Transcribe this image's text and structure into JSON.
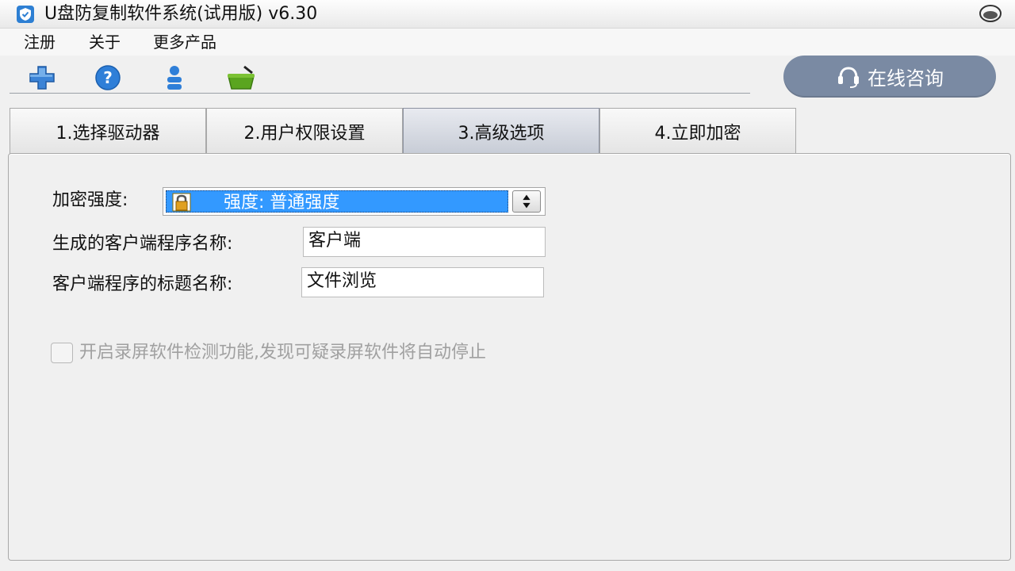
{
  "window": {
    "title": "U盘防复制软件系统(试用版) v6.30"
  },
  "menu": {
    "items": [
      "注册",
      "关于",
      "更多产品"
    ]
  },
  "toolbar": {
    "icons": [
      "add-icon",
      "help-icon",
      "user-icon",
      "basket-icon"
    ]
  },
  "consult": {
    "label": "在线咨询"
  },
  "tabs": [
    {
      "label": "1.选择驱动器",
      "active": false
    },
    {
      "label": "2.用户权限设置",
      "active": false
    },
    {
      "label": "3.高级选项",
      "active": true
    },
    {
      "label": "4.立即加密",
      "active": false
    }
  ],
  "form": {
    "strength_label": "加密强度:",
    "strength_value": "强度: 普通强度",
    "client_name_label": "生成的客户端程序名称:",
    "client_name_value": "客户端",
    "client_title_label": "客户端程序的标题名称:",
    "client_title_value": "文件浏览",
    "screen_record_label": "开启录屏软件检测功能,发现可疑录屏软件将自动停止",
    "screen_record_checked": false,
    "screen_record_enabled": false
  },
  "colors": {
    "select_highlight": "#3399ff",
    "consult_button": "#7a8aa3",
    "active_tab": "#c7ccd6"
  }
}
